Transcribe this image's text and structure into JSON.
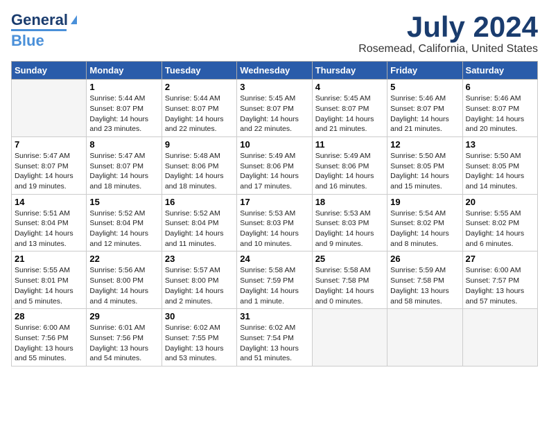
{
  "header": {
    "logo_general": "General",
    "logo_blue": "Blue",
    "month_year": "July 2024",
    "location": "Rosemead, California, United States"
  },
  "days_of_week": [
    "Sunday",
    "Monday",
    "Tuesday",
    "Wednesday",
    "Thursday",
    "Friday",
    "Saturday"
  ],
  "weeks": [
    [
      {
        "day": "",
        "info": ""
      },
      {
        "day": "1",
        "info": "Sunrise: 5:44 AM\nSunset: 8:07 PM\nDaylight: 14 hours\nand 23 minutes."
      },
      {
        "day": "2",
        "info": "Sunrise: 5:44 AM\nSunset: 8:07 PM\nDaylight: 14 hours\nand 22 minutes."
      },
      {
        "day": "3",
        "info": "Sunrise: 5:45 AM\nSunset: 8:07 PM\nDaylight: 14 hours\nand 22 minutes."
      },
      {
        "day": "4",
        "info": "Sunrise: 5:45 AM\nSunset: 8:07 PM\nDaylight: 14 hours\nand 21 minutes."
      },
      {
        "day": "5",
        "info": "Sunrise: 5:46 AM\nSunset: 8:07 PM\nDaylight: 14 hours\nand 21 minutes."
      },
      {
        "day": "6",
        "info": "Sunrise: 5:46 AM\nSunset: 8:07 PM\nDaylight: 14 hours\nand 20 minutes."
      }
    ],
    [
      {
        "day": "7",
        "info": "Sunrise: 5:47 AM\nSunset: 8:07 PM\nDaylight: 14 hours\nand 19 minutes."
      },
      {
        "day": "8",
        "info": "Sunrise: 5:47 AM\nSunset: 8:07 PM\nDaylight: 14 hours\nand 18 minutes."
      },
      {
        "day": "9",
        "info": "Sunrise: 5:48 AM\nSunset: 8:06 PM\nDaylight: 14 hours\nand 18 minutes."
      },
      {
        "day": "10",
        "info": "Sunrise: 5:49 AM\nSunset: 8:06 PM\nDaylight: 14 hours\nand 17 minutes."
      },
      {
        "day": "11",
        "info": "Sunrise: 5:49 AM\nSunset: 8:06 PM\nDaylight: 14 hours\nand 16 minutes."
      },
      {
        "day": "12",
        "info": "Sunrise: 5:50 AM\nSunset: 8:05 PM\nDaylight: 14 hours\nand 15 minutes."
      },
      {
        "day": "13",
        "info": "Sunrise: 5:50 AM\nSunset: 8:05 PM\nDaylight: 14 hours\nand 14 minutes."
      }
    ],
    [
      {
        "day": "14",
        "info": "Sunrise: 5:51 AM\nSunset: 8:04 PM\nDaylight: 14 hours\nand 13 minutes."
      },
      {
        "day": "15",
        "info": "Sunrise: 5:52 AM\nSunset: 8:04 PM\nDaylight: 14 hours\nand 12 minutes."
      },
      {
        "day": "16",
        "info": "Sunrise: 5:52 AM\nSunset: 8:04 PM\nDaylight: 14 hours\nand 11 minutes."
      },
      {
        "day": "17",
        "info": "Sunrise: 5:53 AM\nSunset: 8:03 PM\nDaylight: 14 hours\nand 10 minutes."
      },
      {
        "day": "18",
        "info": "Sunrise: 5:53 AM\nSunset: 8:03 PM\nDaylight: 14 hours\nand 9 minutes."
      },
      {
        "day": "19",
        "info": "Sunrise: 5:54 AM\nSunset: 8:02 PM\nDaylight: 14 hours\nand 8 minutes."
      },
      {
        "day": "20",
        "info": "Sunrise: 5:55 AM\nSunset: 8:02 PM\nDaylight: 14 hours\nand 6 minutes."
      }
    ],
    [
      {
        "day": "21",
        "info": "Sunrise: 5:55 AM\nSunset: 8:01 PM\nDaylight: 14 hours\nand 5 minutes."
      },
      {
        "day": "22",
        "info": "Sunrise: 5:56 AM\nSunset: 8:00 PM\nDaylight: 14 hours\nand 4 minutes."
      },
      {
        "day": "23",
        "info": "Sunrise: 5:57 AM\nSunset: 8:00 PM\nDaylight: 14 hours\nand 2 minutes."
      },
      {
        "day": "24",
        "info": "Sunrise: 5:58 AM\nSunset: 7:59 PM\nDaylight: 14 hours\nand 1 minute."
      },
      {
        "day": "25",
        "info": "Sunrise: 5:58 AM\nSunset: 7:58 PM\nDaylight: 14 hours\nand 0 minutes."
      },
      {
        "day": "26",
        "info": "Sunrise: 5:59 AM\nSunset: 7:58 PM\nDaylight: 13 hours\nand 58 minutes."
      },
      {
        "day": "27",
        "info": "Sunrise: 6:00 AM\nSunset: 7:57 PM\nDaylight: 13 hours\nand 57 minutes."
      }
    ],
    [
      {
        "day": "28",
        "info": "Sunrise: 6:00 AM\nSunset: 7:56 PM\nDaylight: 13 hours\nand 55 minutes."
      },
      {
        "day": "29",
        "info": "Sunrise: 6:01 AM\nSunset: 7:56 PM\nDaylight: 13 hours\nand 54 minutes."
      },
      {
        "day": "30",
        "info": "Sunrise: 6:02 AM\nSunset: 7:55 PM\nDaylight: 13 hours\nand 53 minutes."
      },
      {
        "day": "31",
        "info": "Sunrise: 6:02 AM\nSunset: 7:54 PM\nDaylight: 13 hours\nand 51 minutes."
      },
      {
        "day": "",
        "info": ""
      },
      {
        "day": "",
        "info": ""
      },
      {
        "day": "",
        "info": ""
      }
    ]
  ]
}
